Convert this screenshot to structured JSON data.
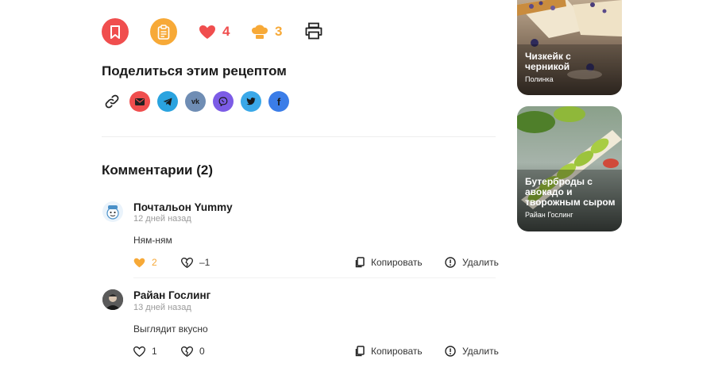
{
  "actions": {
    "likes_count": "4",
    "chef_count": "3"
  },
  "share": {
    "title": "Поделиться этим рецептом",
    "icons": [
      "link-icon",
      "mail-icon",
      "telegram-icon",
      "vk-icon",
      "viber-icon",
      "twitter-icon",
      "facebook-icon"
    ]
  },
  "comments": {
    "title": "Комментарии (2)",
    "items": [
      {
        "author": "Почтальон Yummy",
        "date": "12 дней назад",
        "text": "Ням-ням",
        "likes": "2",
        "dislikes": "–1",
        "copy_label": "Копировать",
        "delete_label": "Удалить"
      },
      {
        "author": "Райан Гослинг",
        "date": "13 дней назад",
        "text": "Выглядит вкусно",
        "likes": "1",
        "dislikes": "0",
        "copy_label": "Копировать",
        "delete_label": "Удалить"
      }
    ]
  },
  "recipes": [
    {
      "title": "Чизкейк с черникой",
      "author": "Полинка"
    },
    {
      "title": "Бутерброды с авокадо и творожным сыром",
      "author": "Райан Гослинг"
    }
  ],
  "colors": {
    "bookmark": "#f04e4e",
    "clipboard": "#f7a937",
    "heart": "#f04e4e",
    "chef": "#f7a937"
  }
}
